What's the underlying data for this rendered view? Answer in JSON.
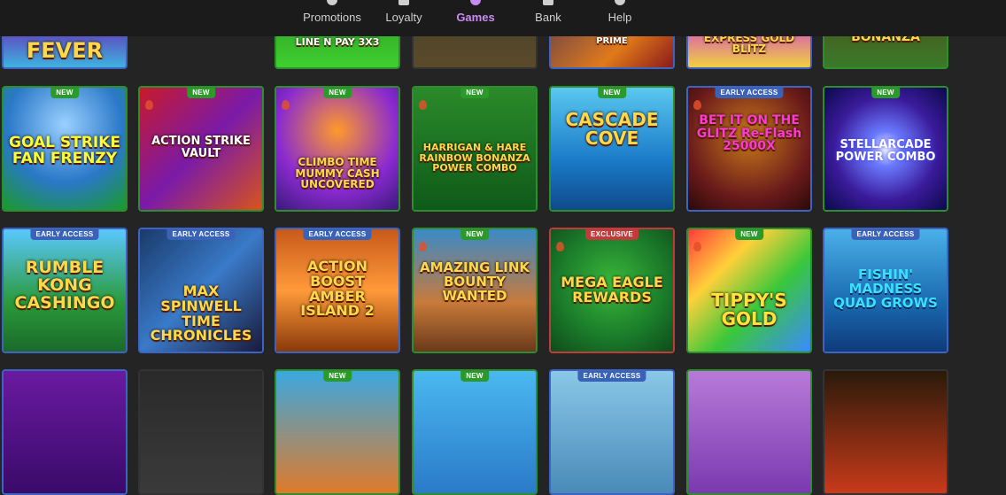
{
  "nav": {
    "items": [
      {
        "label": "Promotions",
        "icon": "home-icon"
      },
      {
        "label": "Loyalty",
        "icon": "crown-icon"
      },
      {
        "label": "Games",
        "icon": "games-icon",
        "active": true
      },
      {
        "label": "Bank",
        "icon": "bank-icon"
      },
      {
        "label": "Help",
        "icon": "help-icon"
      }
    ],
    "active_color": "#c88bf2"
  },
  "row0": [
    {
      "title": "FEVER"
    },
    {
      "title": "LINE N PAY 3X3"
    },
    {
      "title": ""
    },
    {
      "title": "PRIME"
    },
    {
      "title": "EXPRESS GOLD BLITZ"
    },
    {
      "title": "BONANZA"
    }
  ],
  "row1": [
    {
      "badge": "NEW",
      "title": "GOAL STRIKE FAN FRENZY"
    },
    {
      "badge": "NEW",
      "title": "ACTION STRIKE VAULT"
    },
    {
      "badge": "NEW",
      "title": "CLIMBO TIME MUMMY CASH UNCOVERED"
    },
    {
      "badge": "NEW",
      "title": "HARRIGAN & HARE RAINBOW BONANZA POWER COMBO"
    },
    {
      "badge": "NEW",
      "title": "CASCADE COVE"
    },
    {
      "badge": "EARLY ACCESS",
      "title": "BET IT ON THE GLITZ Re-Flash 25000X"
    },
    {
      "badge": "NEW",
      "title": "STELLARCADE POWER COMBO"
    }
  ],
  "row2": [
    {
      "badge": "EARLY ACCESS",
      "title": "RUMBLE KONG CASHINGO"
    },
    {
      "badge": "EARLY ACCESS",
      "title": "MAX SPINWELL TIME CHRONICLES"
    },
    {
      "badge": "EARLY ACCESS",
      "title": "ACTION BOOST AMBER ISLAND 2"
    },
    {
      "badge": "NEW",
      "title": "AMAZING LINK BOUNTY WANTED"
    },
    {
      "badge": "EXCLUSIVE",
      "title": "MEGA EAGLE REWARDS"
    },
    {
      "badge": "NEW",
      "title": "TIPPY'S GOLD"
    },
    {
      "badge": "EARLY ACCESS",
      "title": "FISHIN' MADNESS QUAD GROWS"
    }
  ],
  "row3": [
    {
      "badge": ""
    },
    {
      "badge": ""
    },
    {
      "badge": "NEW"
    },
    {
      "badge": "NEW"
    },
    {
      "badge": "EARLY ACCESS"
    },
    {
      "badge": ""
    },
    {
      "badge": ""
    }
  ]
}
